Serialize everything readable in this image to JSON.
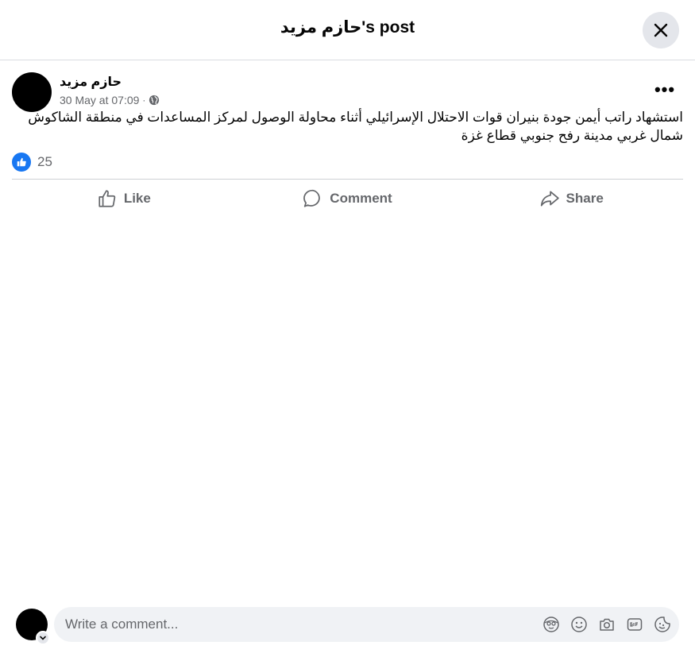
{
  "header": {
    "title": "حازم مزيد's post"
  },
  "post": {
    "author": "حازم مزيد",
    "date": "30 May at 07:09",
    "separator": "·",
    "text": "استشهاد راتب أيمن جودة بنيران قوات الاحتلال الإسرائيلي أثناء محاولة الوصول لمركز المساعدات في منطقة الشاكوش شمال غربي مدينة رفح جنوبي قطاع غزة",
    "reaction_count": "25",
    "more_label": "•••"
  },
  "actions": {
    "like": "Like",
    "comment": "Comment",
    "share": "Share"
  },
  "composer": {
    "placeholder": "Write a comment..."
  },
  "icons": {
    "close": "close-icon",
    "globe": "globe-icon",
    "more": "more-icon",
    "like_badge": "thumbs-up-icon",
    "like": "thumbs-up-icon",
    "comment": "comment-bubble-icon",
    "share": "share-arrow-icon",
    "avatar_icon": "avatar-icon",
    "emoji": "emoji-icon",
    "camera": "camera-icon",
    "gif": "gif-icon",
    "sticker": "sticker-icon"
  },
  "colors": {
    "accent": "#1877f2",
    "secondary_text": "#65676b",
    "input_bg": "#f0f2f5"
  }
}
